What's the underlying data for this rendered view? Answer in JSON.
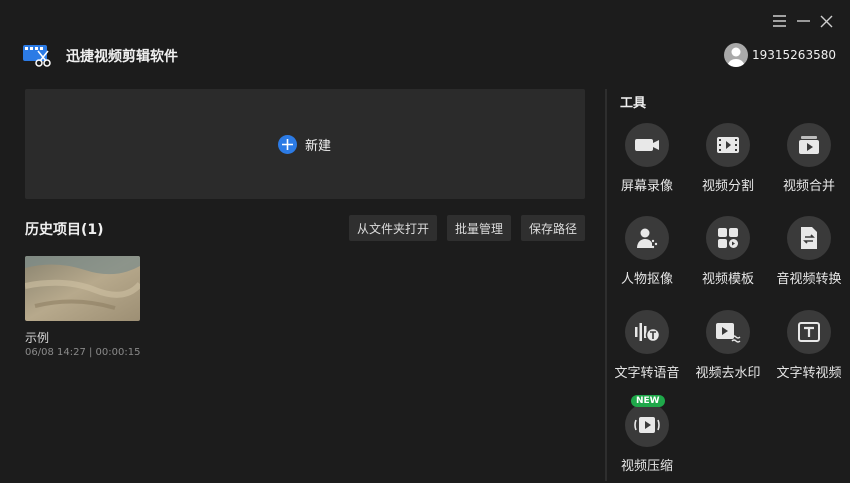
{
  "app": {
    "title": "迅捷视频剪辑软件"
  },
  "user": {
    "id": "19315263580"
  },
  "new_project": {
    "label": "新建"
  },
  "history": {
    "title": "历史项目(1)",
    "actions": {
      "open_folder": "从文件夹打开",
      "batch_manage": "批量管理",
      "save_path": "保存路径"
    },
    "items": [
      {
        "name": "示例",
        "meta": "06/08 14:27 | 00:00:15"
      }
    ]
  },
  "tools": {
    "title": "工具",
    "items": [
      {
        "label": "屏幕录像",
        "icon": "camera-icon"
      },
      {
        "label": "视频分割",
        "icon": "film-split-icon"
      },
      {
        "label": "视频合并",
        "icon": "video-merge-icon"
      },
      {
        "label": "人物抠像",
        "icon": "person-cutout-icon"
      },
      {
        "label": "视频模板",
        "icon": "template-icon"
      },
      {
        "label": "音视频转换",
        "icon": "convert-icon"
      },
      {
        "label": "文字转语音",
        "icon": "text-to-speech-icon"
      },
      {
        "label": "视频去水印",
        "icon": "remove-watermark-icon"
      },
      {
        "label": "文字转视频",
        "icon": "text-to-video-icon"
      },
      {
        "label": "视频压缩",
        "icon": "compress-icon",
        "badge": "NEW"
      }
    ]
  },
  "colors": {
    "accent": "#2c7be5",
    "badge": "#1fa84a",
    "background": "#1c1c1c",
    "panel": "#2b2b2b"
  }
}
